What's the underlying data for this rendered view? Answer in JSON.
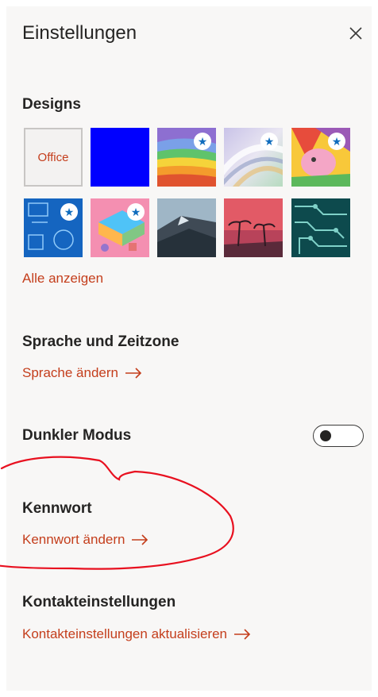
{
  "panel": {
    "title": "Einstellungen",
    "close_icon": "close-icon"
  },
  "designs": {
    "heading": "Designs",
    "office_label": "Office",
    "star_glyph": "★",
    "show_all": "Alle anzeigen",
    "themes": [
      {
        "name": "Office",
        "starred": false
      },
      {
        "name": "Blue",
        "starred": false
      },
      {
        "name": "Rainbow waves",
        "starred": true
      },
      {
        "name": "Silver ribbons",
        "starred": true
      },
      {
        "name": "Pink dragon",
        "starred": true
      },
      {
        "name": "Blueprint sketch",
        "starred": true
      },
      {
        "name": "Colorful game",
        "starred": true
      },
      {
        "name": "Mountain",
        "starred": false
      },
      {
        "name": "Palm sunset",
        "starred": false
      },
      {
        "name": "Circuit board",
        "starred": false
      }
    ]
  },
  "language": {
    "heading": "Sprache und Zeitzone",
    "link": "Sprache ändern"
  },
  "dark_mode": {
    "heading": "Dunkler Modus",
    "enabled": false
  },
  "password": {
    "heading": "Kennwort",
    "link": "Kennwort ändern"
  },
  "contact": {
    "heading": "Kontakteinstellungen",
    "link": "Kontakteinstellungen aktualisieren"
  },
  "colors": {
    "accent": "#c43e1c",
    "annotation": "#e8101f",
    "background": "#f8f7f6"
  }
}
